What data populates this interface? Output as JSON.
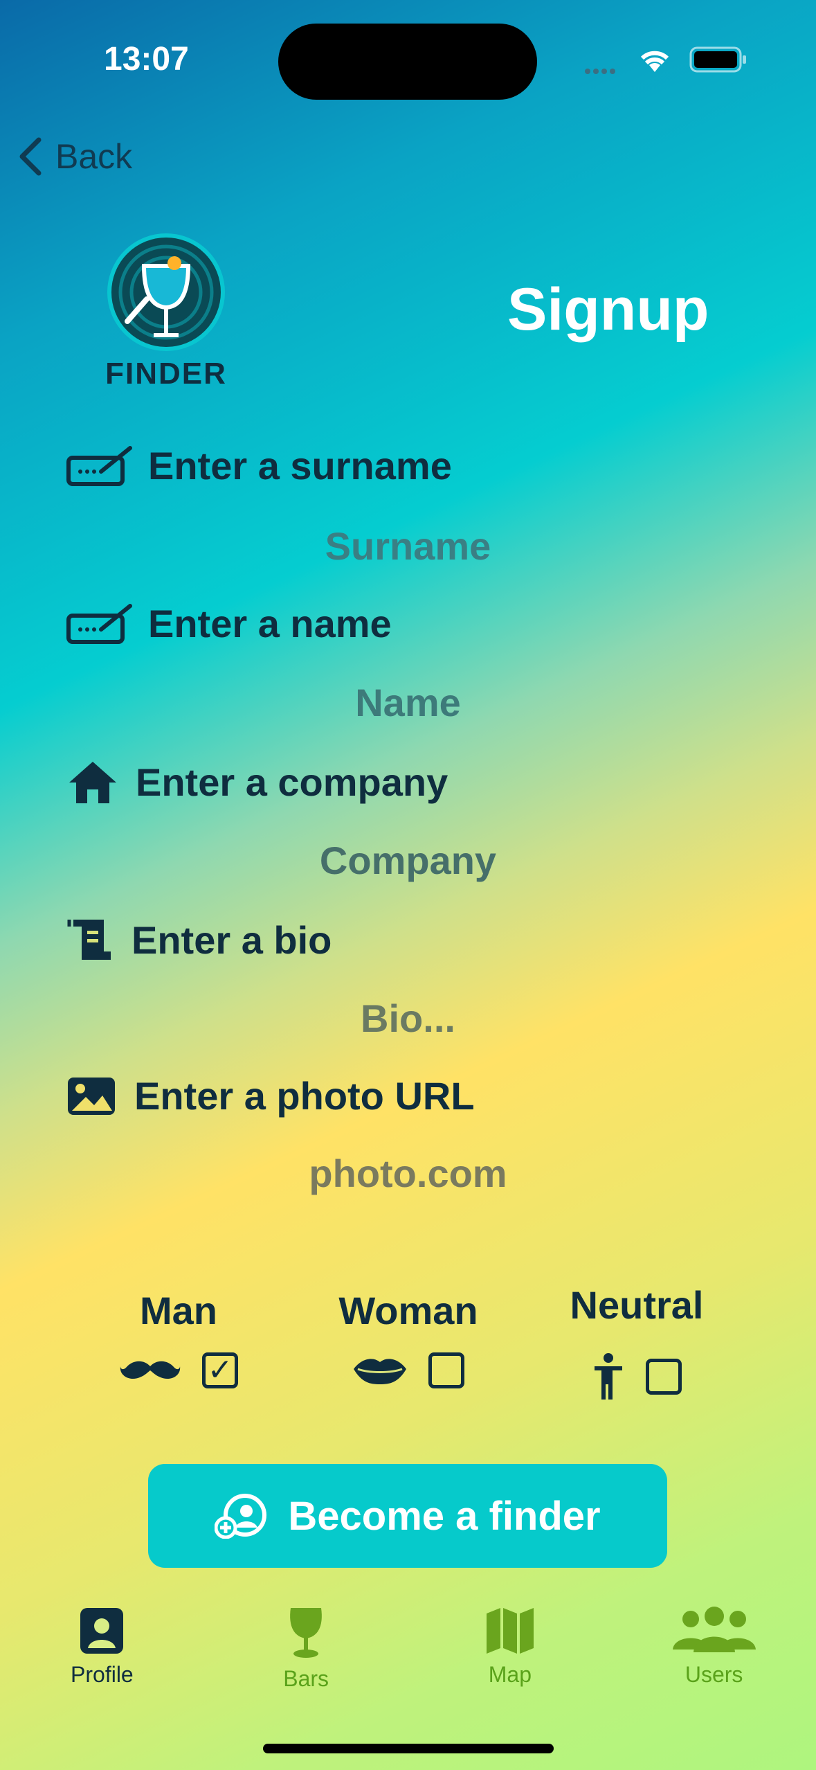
{
  "status": {
    "time": "13:07"
  },
  "nav": {
    "back_label": "Back"
  },
  "brand": {
    "logo_text": "FINDER"
  },
  "page": {
    "title": "Signup"
  },
  "form": {
    "surname": {
      "label": "Enter a surname",
      "placeholder": "Surname",
      "icon": "signature-icon"
    },
    "name": {
      "label": "Enter a name",
      "placeholder": "Name",
      "icon": "signature-icon"
    },
    "company": {
      "label": "Enter a company",
      "placeholder": "Company",
      "icon": "house-icon"
    },
    "bio": {
      "label": "Enter a bio",
      "placeholder": "Bio...",
      "icon": "scroll-icon"
    },
    "photo": {
      "label": "Enter a photo URL",
      "placeholder": "photo.com",
      "icon": "image-icon"
    }
  },
  "gender": {
    "man": {
      "label": "Man",
      "checked": true,
      "icon": "mustache-icon"
    },
    "woman": {
      "label": "Woman",
      "checked": false,
      "icon": "lips-icon"
    },
    "neutral": {
      "label": "Neutral",
      "checked": false,
      "icon": "person-icon"
    }
  },
  "cta": {
    "label": "Become a finder",
    "icon": "user-plus-icon"
  },
  "tabs": [
    {
      "label": "Profile",
      "icon": "profile-icon",
      "active": true
    },
    {
      "label": "Bars",
      "icon": "wine-glass-icon",
      "active": false
    },
    {
      "label": "Map",
      "icon": "map-icon",
      "active": false
    },
    {
      "label": "Users",
      "icon": "users-icon",
      "active": false
    }
  ],
  "colors": {
    "active_tab": "#0f2d3f",
    "inactive_tab": "#5aa21a",
    "cta": "#06cacb",
    "placeholder": "#3d6f72"
  }
}
